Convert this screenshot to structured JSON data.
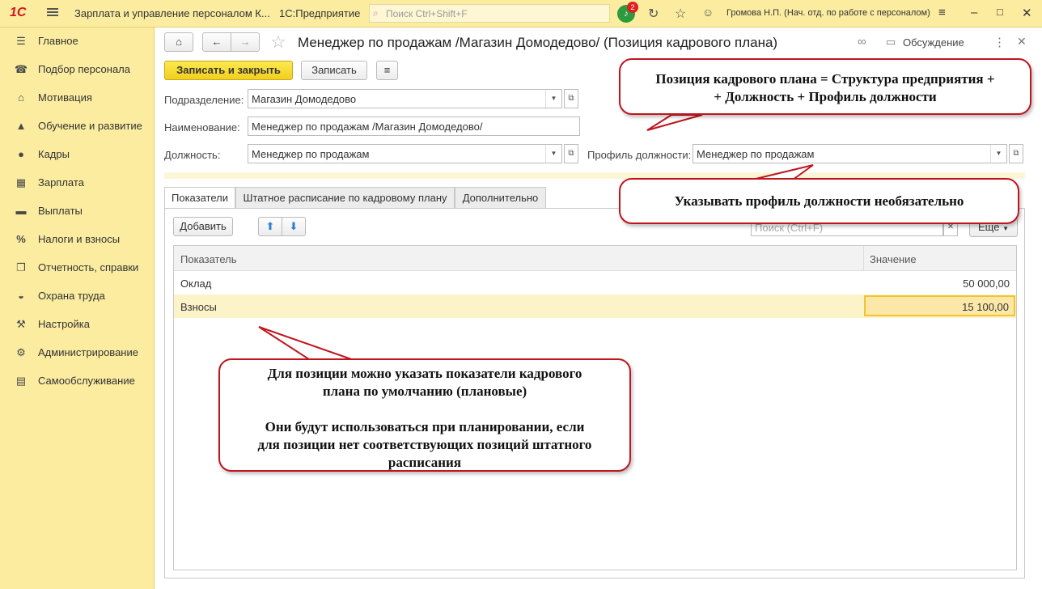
{
  "app": {
    "logo": "1С",
    "title": "Зарплата и управление персоналом К...",
    "platform": "1С:Предприятие",
    "search_placeholder": "Поиск Ctrl+Shift+F",
    "notifications": "2",
    "user": "Громова Н.П. (Нач. отд. по работе с персоналом)"
  },
  "sidebar": {
    "items": [
      {
        "label": "Главное",
        "icon": "menu-icon"
      },
      {
        "label": "Подбор персонала",
        "icon": "phone-icon"
      },
      {
        "label": "Мотивация",
        "icon": "gift-icon"
      },
      {
        "label": "Обучение и развитие",
        "icon": "graduation-cap-icon"
      },
      {
        "label": "Кадры",
        "icon": "people-icon"
      },
      {
        "label": "Зарплата",
        "icon": "calculator-icon"
      },
      {
        "label": "Выплаты",
        "icon": "payment-icon"
      },
      {
        "label": "Налоги и взносы",
        "icon": "percent-icon"
      },
      {
        "label": "Отчетность, справки",
        "icon": "report-icon"
      },
      {
        "label": "Охрана труда",
        "icon": "helmet-icon"
      },
      {
        "label": "Настройка",
        "icon": "wrench-icon"
      },
      {
        "label": "Администрирование",
        "icon": "gear-icon"
      },
      {
        "label": "Самообслуживание",
        "icon": "id-card-icon"
      }
    ]
  },
  "form": {
    "title": "Менеджер по продажам /Магазин Домодедово/ (Позиция кадрового плана)",
    "discussion": "Обсуждение",
    "save_close": "Записать и закрыть",
    "save": "Записать",
    "department_label": "Подразделение:",
    "department_value": "Магазин Домодедово",
    "name_label": "Наименование:",
    "name_value": "Менеджер по продажам /Магазин Домодедово/",
    "position_label": "Должность:",
    "position_value": "Менеджер по продажам",
    "profile_label": "Профиль должности:",
    "profile_value": "Менеджер по продажам"
  },
  "tabs": [
    {
      "label": "Показатели",
      "active": true
    },
    {
      "label": "Штатное расписание по кадровому плану",
      "active": false
    },
    {
      "label": "Дополнительно",
      "active": false
    }
  ],
  "table_toolbar": {
    "add": "Добавить",
    "search_placeholder": "Поиск (Ctrl+F)",
    "more": "Еще"
  },
  "table": {
    "columns": [
      "Показатель",
      "Значение"
    ],
    "rows": [
      {
        "indicator": "Оклад",
        "value": "50 000,00"
      },
      {
        "indicator": "Взносы",
        "value": "15 100,00"
      }
    ]
  },
  "callouts": {
    "formula_line1": "Позиция кадрового плана = Структура предприятия +",
    "formula_line2": "+ Должность + Профиль должности",
    "profile_note": "Указывать профиль должности необязательно",
    "indicators_line1": "Для позиции можно указать показатели кадрового",
    "indicators_line2": "плана по умолчанию (плановые)",
    "indicators_line3": "Они будут использоваться при планировании, если",
    "indicators_line4": "для позиции нет соответствующих позиций штатного",
    "indicators_line5": "расписания"
  },
  "colors": {
    "header_bg": "#fbeca0",
    "primary_button": "#f5d52a",
    "selected_row": "#fdf3c8",
    "callout_border": "#c0151d"
  }
}
